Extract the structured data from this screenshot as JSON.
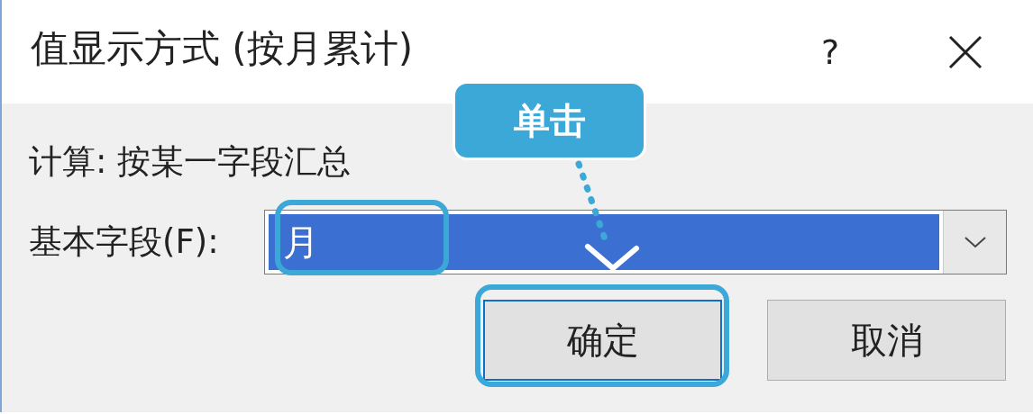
{
  "window": {
    "title": "值显示方式 (按月累计)",
    "help": "?"
  },
  "calculation": "计算: 按某一字段汇总",
  "base_field": {
    "label": "基本字段(F):",
    "value": "月",
    "selected": true
  },
  "buttons": [
    {
      "label": "确定",
      "highlighted": true
    },
    {
      "label": "取消",
      "highlighted": false
    }
  ],
  "callout": {
    "text": "单击"
  }
}
